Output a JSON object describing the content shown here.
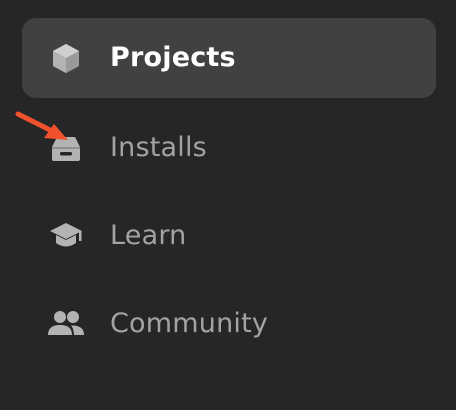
{
  "sidebar": {
    "items": [
      {
        "label": "Projects",
        "icon": "cube-icon",
        "active": true
      },
      {
        "label": "Installs",
        "icon": "hard-drive-icon",
        "active": false
      },
      {
        "label": "Learn",
        "icon": "graduation-cap-icon",
        "active": false
      },
      {
        "label": "Community",
        "icon": "people-icon",
        "active": false
      }
    ]
  },
  "colors": {
    "background": "#262626",
    "active_bg": "#414141",
    "active_text": "#ffffff",
    "inactive_text": "#a3a3a3",
    "icon": "#b3b3b3",
    "annotation_arrow": "#f0522d"
  }
}
